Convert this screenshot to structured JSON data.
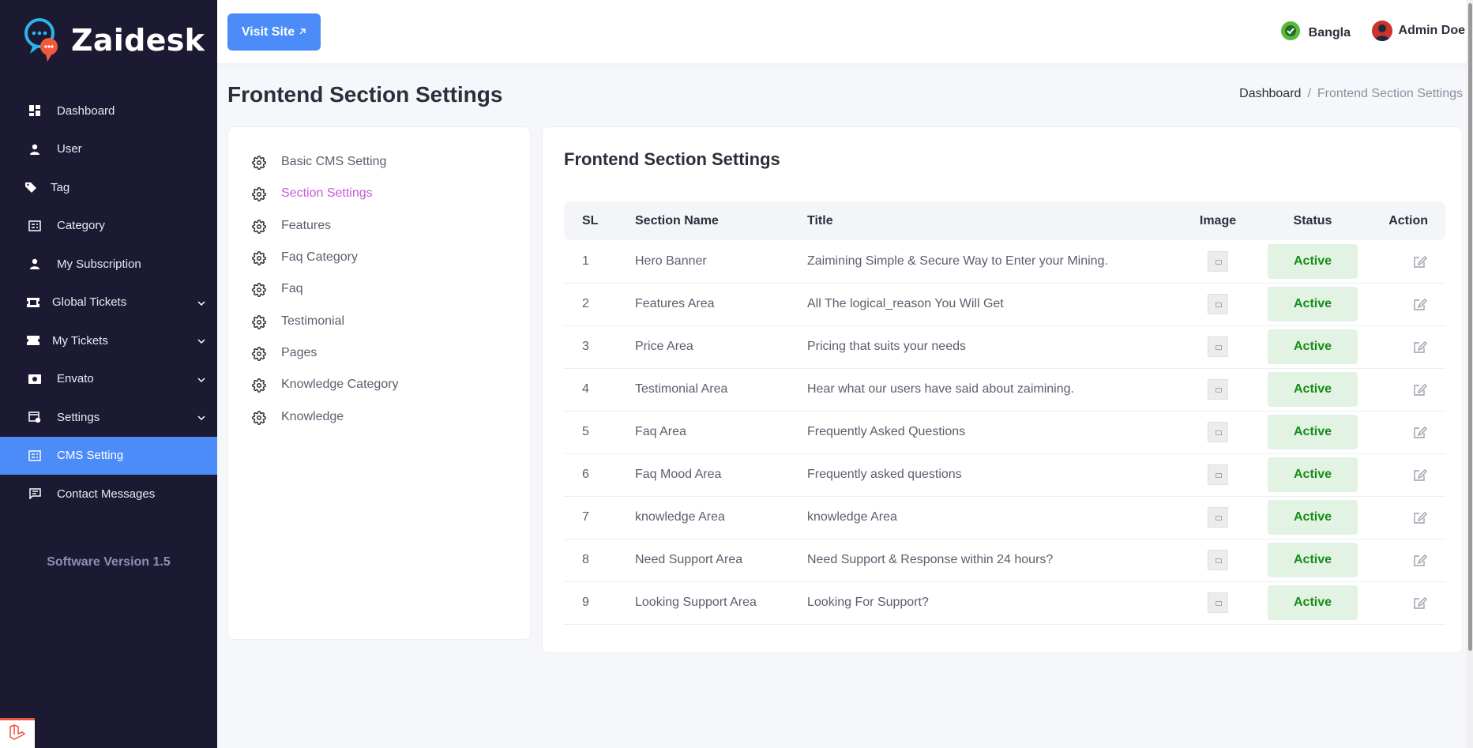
{
  "app": {
    "name": "Zaidesk"
  },
  "sidebar": {
    "items": [
      {
        "label": "Dashboard",
        "icon": "dashboard-icon"
      },
      {
        "label": "User",
        "icon": "user-icon"
      },
      {
        "label": "Tag",
        "icon": "tag-icon"
      },
      {
        "label": "Category",
        "icon": "category-icon"
      },
      {
        "label": "My Subscription",
        "icon": "user-icon"
      },
      {
        "label": "Global Tickets",
        "icon": "ticket-icon",
        "expandable": true
      },
      {
        "label": "My Tickets",
        "icon": "ticket-icon",
        "expandable": true
      },
      {
        "label": "Envato",
        "icon": "envato-icon",
        "expandable": true
      },
      {
        "label": "Settings",
        "icon": "settings-icon",
        "expandable": true
      },
      {
        "label": "CMS Setting",
        "icon": "cms-icon",
        "active": true
      },
      {
        "label": "Contact Messages",
        "icon": "message-icon"
      }
    ],
    "version": "Software Version 1.5"
  },
  "topbar": {
    "visit_site": "Visit Site",
    "language": "Bangla",
    "user_name": "Admin Doe"
  },
  "page": {
    "title": "Frontend Section Settings",
    "breadcrumb": {
      "home": "Dashboard",
      "separator": "/",
      "current": "Frontend Section Settings"
    }
  },
  "settings_menu": [
    {
      "label": "Basic CMS Setting"
    },
    {
      "label": "Section Settings",
      "active": true
    },
    {
      "label": "Features"
    },
    {
      "label": "Faq Category"
    },
    {
      "label": "Faq"
    },
    {
      "label": "Testimonial"
    },
    {
      "label": "Pages"
    },
    {
      "label": "Knowledge Category"
    },
    {
      "label": "Knowledge"
    }
  ],
  "main": {
    "title": "Frontend Section Settings",
    "columns": [
      "SL",
      "Section Name",
      "Title",
      "Image",
      "Status",
      "Action"
    ],
    "rows": [
      {
        "sl": "1",
        "name": "Hero Banner",
        "title": "Zaimining Simple & Secure Way to Enter your Mining.",
        "status": "Active"
      },
      {
        "sl": "2",
        "name": "Features Area",
        "title": "All The logical_reason You Will Get",
        "status": "Active"
      },
      {
        "sl": "3",
        "name": "Price Area",
        "title": "Pricing that suits your needs",
        "status": "Active"
      },
      {
        "sl": "4",
        "name": "Testimonial Area",
        "title": "Hear what our users have said about zaimining.",
        "status": "Active"
      },
      {
        "sl": "5",
        "name": "Faq Area",
        "title": "Frequently Asked Questions",
        "status": "Active"
      },
      {
        "sl": "6",
        "name": "Faq Mood Area",
        "title": "Frequently asked questions",
        "status": "Active"
      },
      {
        "sl": "7",
        "name": "knowledge Area",
        "title": "knowledge Area",
        "status": "Active"
      },
      {
        "sl": "8",
        "name": "Need Support Area",
        "title": "Need Support & Response within 24 hours?",
        "status": "Active"
      },
      {
        "sl": "9",
        "name": "Looking Support Area",
        "title": "Looking For Support?",
        "status": "Active"
      }
    ]
  },
  "colors": {
    "sidebar_bg": "#1b1a32",
    "accent": "#4c8cf8",
    "active_menu": "#c65bd8",
    "status_bg": "#e2f3e3",
    "status_text": "#1a8a1a"
  }
}
